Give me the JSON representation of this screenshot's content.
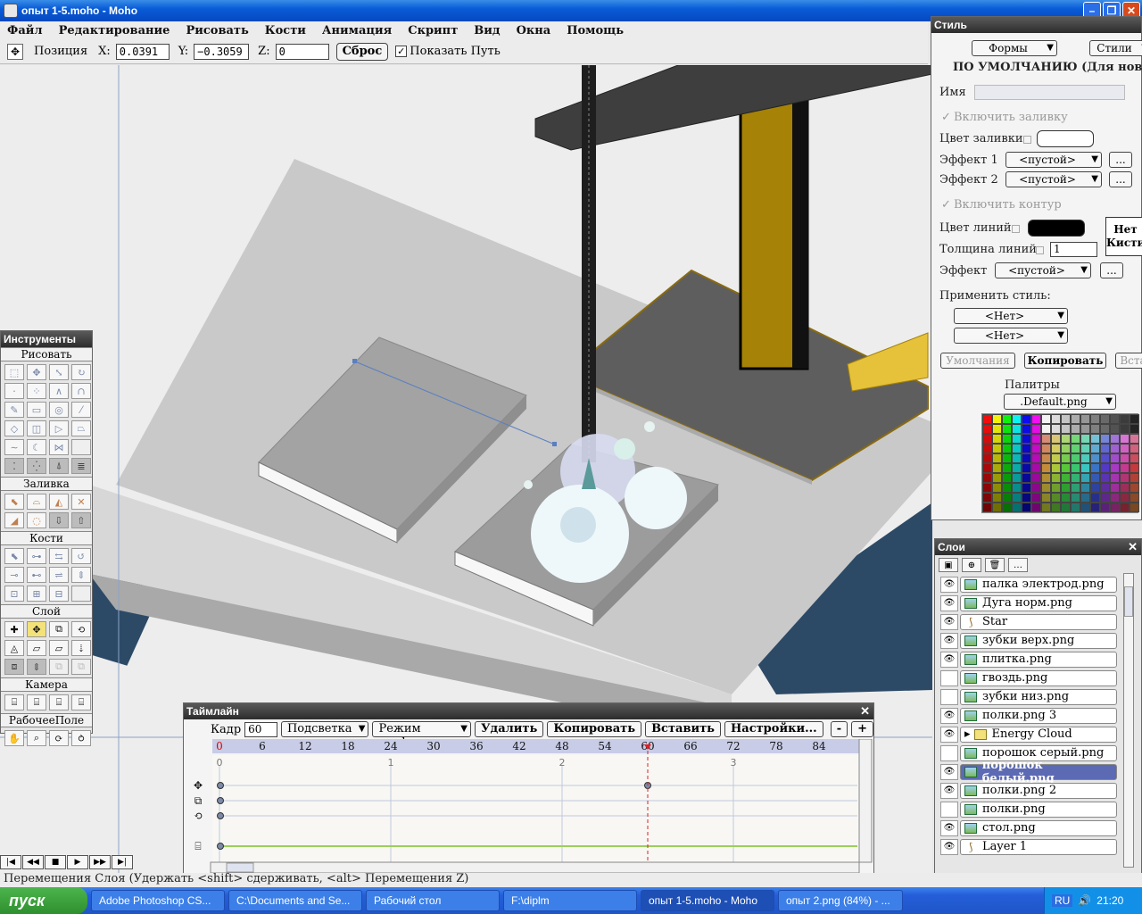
{
  "window": {
    "title": "опыт 1-5.moho - Moho"
  },
  "menu": [
    "Файл",
    "Редактирование",
    "Рисовать",
    "Кости",
    "Анимация",
    "Скрипт",
    "Вид",
    "Окна",
    "Помощь"
  ],
  "options": {
    "position_label": "Позиция",
    "x_label": "X:",
    "x_value": "0.0391",
    "y_label": "Y:",
    "y_value": "−0.3059",
    "z_label": "Z:",
    "z_value": "0",
    "reset_label": "Сброс",
    "show_path_label": "Показать Путь",
    "show_path_checked": true
  },
  "tools": {
    "title": "Инструменты",
    "sections": [
      "Рисовать",
      "Заливка",
      "Кости",
      "Слой",
      "Камера",
      "РабочееПоле"
    ]
  },
  "style": {
    "title": "Стиль",
    "shapes_btn": "Формы",
    "styles_btn": "Стили",
    "header": "ПО УМОЛЧАНИЮ (Для новых ф",
    "name_label": "Имя",
    "enable_fill": "Включить заливку",
    "fill_color_label": "Цвет заливки",
    "effect1_label": "Эффект 1",
    "effect2_label": "Эффект 2",
    "empty_option": "<пустой>",
    "enable_stroke": "Включить контур",
    "line_color_label": "Цвет линий",
    "line_width_label": "Толщина линий",
    "line_width_value": "1",
    "effect_label": "Эффект",
    "brush_none_1": "Нет",
    "brush_none_2": "Кисти",
    "apply_style_label": "Применить стиль:",
    "none_option": "<Нет>",
    "defaults_btn": "Умолчания",
    "copy_btn": "Копировать",
    "paste_btn": "Вста",
    "palettes_label": "Палитры",
    "palette_selected": ".Default.png",
    "colors": {
      "line": "#000000",
      "fill": "#ffffff"
    }
  },
  "layers": {
    "title": "Слои",
    "items": [
      {
        "name": "палка электрод.png",
        "visible": true,
        "type": "image",
        "selected": false
      },
      {
        "name": "Дуга норм.png",
        "visible": true,
        "type": "image",
        "selected": false
      },
      {
        "name": "Star",
        "visible": true,
        "type": "bone",
        "selected": false
      },
      {
        "name": "зубки верх.png",
        "visible": true,
        "type": "image",
        "selected": false
      },
      {
        "name": "плитка.png",
        "visible": true,
        "type": "image",
        "selected": false
      },
      {
        "name": "гвоздь.png",
        "visible": false,
        "type": "image",
        "selected": false
      },
      {
        "name": "зубки низ.png",
        "visible": false,
        "type": "image",
        "selected": false
      },
      {
        "name": "полки.png 3",
        "visible": true,
        "type": "image",
        "selected": false
      },
      {
        "name": "Energy Cloud",
        "visible": true,
        "type": "group",
        "selected": false
      },
      {
        "name": "порошок серый.png",
        "visible": false,
        "type": "image",
        "selected": false
      },
      {
        "name": "порошок белый.png",
        "visible": true,
        "type": "image",
        "selected": true
      },
      {
        "name": "полки.png 2",
        "visible": true,
        "type": "image",
        "selected": false
      },
      {
        "name": "полки.png",
        "visible": false,
        "type": "image",
        "selected": false
      },
      {
        "name": "стол.png",
        "visible": true,
        "type": "image",
        "selected": false
      },
      {
        "name": "Layer 1",
        "visible": true,
        "type": "bone",
        "selected": false
      }
    ]
  },
  "timeline": {
    "title": "Таймлайн",
    "frame_label": "Кадр",
    "frame_value": "60",
    "onion_label": "Подсветка",
    "graph_mode_label": "Режим графика",
    "delete_label": "Удалить",
    "copy_label": "Копировать",
    "paste_label": "Вставить",
    "settings_label": "Настройки...",
    "minus_label": "-",
    "plus_label": "+",
    "frame_ticks": [
      "0",
      "6",
      "12",
      "18",
      "24",
      "30",
      "36",
      "42",
      "48",
      "54",
      "60",
      "66",
      "72",
      "78",
      "84"
    ],
    "second_ticks": [
      "0",
      "1",
      "2",
      "3"
    ],
    "current_frame": 60
  },
  "status": {
    "text": "Перемещения Слоя (Удержать <shift> сдерживать, <alt> Перемещения Z)"
  },
  "taskbar": {
    "start_label": "пуск",
    "tasks": [
      {
        "label": "Adobe Photoshop CS...",
        "active": false
      },
      {
        "label": "C:\\Documents and Se...",
        "active": false
      },
      {
        "label": "Рабочий стол",
        "active": false
      },
      {
        "label": "F:\\diplm",
        "active": false
      },
      {
        "label": "опыт 1-5.moho - Moho",
        "active": true
      },
      {
        "label": "опыт 2.png (84%) - ...",
        "active": false
      }
    ],
    "lang": "RU",
    "clock": "21:20"
  }
}
